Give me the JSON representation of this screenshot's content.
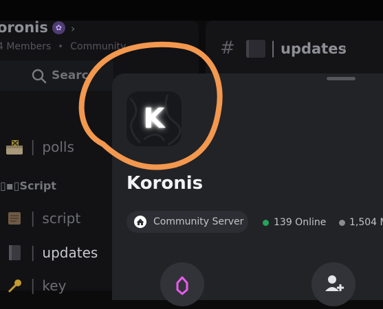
{
  "sidebar": {
    "server_name": "oronis",
    "server_meta": {
      "members": "4 Members",
      "type": "Community"
    },
    "search_label": "Searc",
    "category": "▯▪▯Script",
    "channels": [
      {
        "emoji": "mailbox",
        "name": "polls",
        "active": false
      },
      {
        "emoji": "scroll",
        "name": "script",
        "active": false
      },
      {
        "emoji": "notebook",
        "name": "updates",
        "active": true
      },
      {
        "emoji": "key",
        "name": "key",
        "active": false
      }
    ]
  },
  "header": {
    "hash": "#",
    "pipe": "|",
    "title": "updates"
  },
  "sheet": {
    "icon_letter": "K",
    "title": "Koronis",
    "community_label": "Community Server",
    "online": "139 Online",
    "members": "1,504 M"
  },
  "colors": {
    "accent_online": "#23a55a",
    "annotation": "#f3984e",
    "boost": "#e85cf0"
  }
}
